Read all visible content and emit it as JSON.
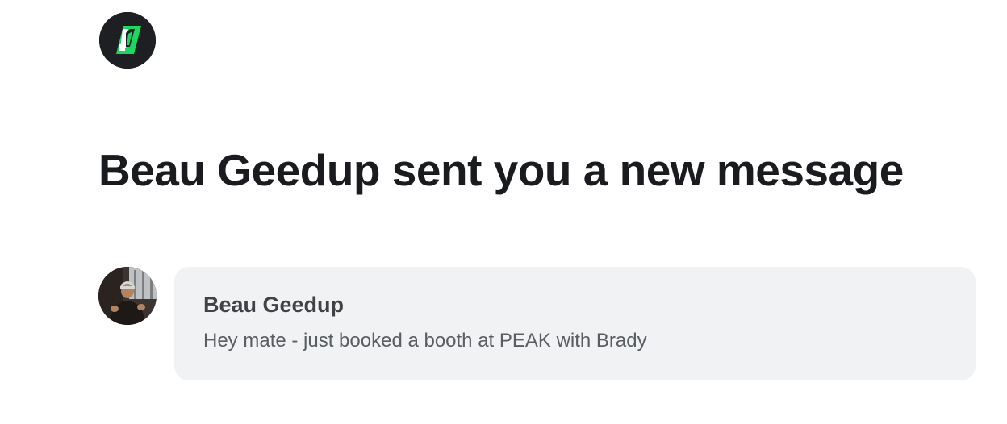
{
  "brand": {
    "logo_icon": "brand-logo-icon",
    "colors": {
      "background": "#1e1f22",
      "accent": "#1ed760",
      "mark": "#ffffff"
    }
  },
  "notification": {
    "headline": "Beau Geedup sent you a new message"
  },
  "message": {
    "avatar_icon": "user-avatar",
    "sender_name": "Beau Geedup",
    "preview": "Hey mate - just booked a booth at PEAK with Brady",
    "colors": {
      "card_background": "#f1f2f4",
      "name": "#404247",
      "text": "#5a5d63"
    }
  }
}
